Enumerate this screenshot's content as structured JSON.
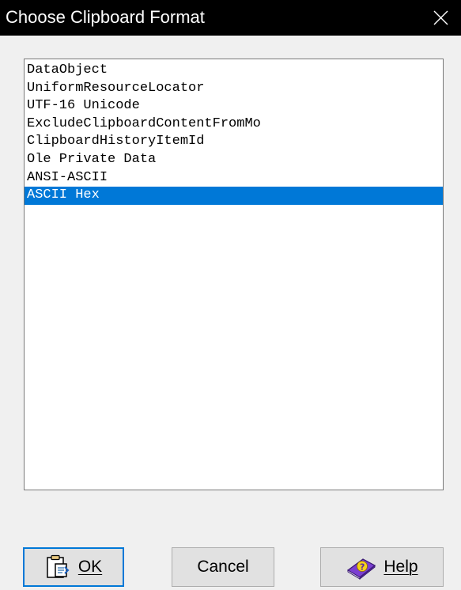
{
  "window": {
    "title": "Choose Clipboard Format"
  },
  "formats": {
    "items": [
      "DataObject",
      "UniformResourceLocator",
      "UTF-16 Unicode",
      "ExcludeClipboardContentFromMo",
      "ClipboardHistoryItemId",
      "Ole Private Data",
      "ANSI-ASCII",
      "ASCII Hex"
    ],
    "selected": "ASCII Hex"
  },
  "buttons": {
    "ok_label": "OK",
    "cancel_label": "Cancel",
    "help_label": "Help"
  },
  "icons": {
    "ok": "clipboard-paste-icon",
    "help": "help-book-icon",
    "close": "close-icon"
  },
  "colors": {
    "titlebar": "#000000",
    "selection": "#0078d7",
    "default_button_border": "#0078d7"
  }
}
